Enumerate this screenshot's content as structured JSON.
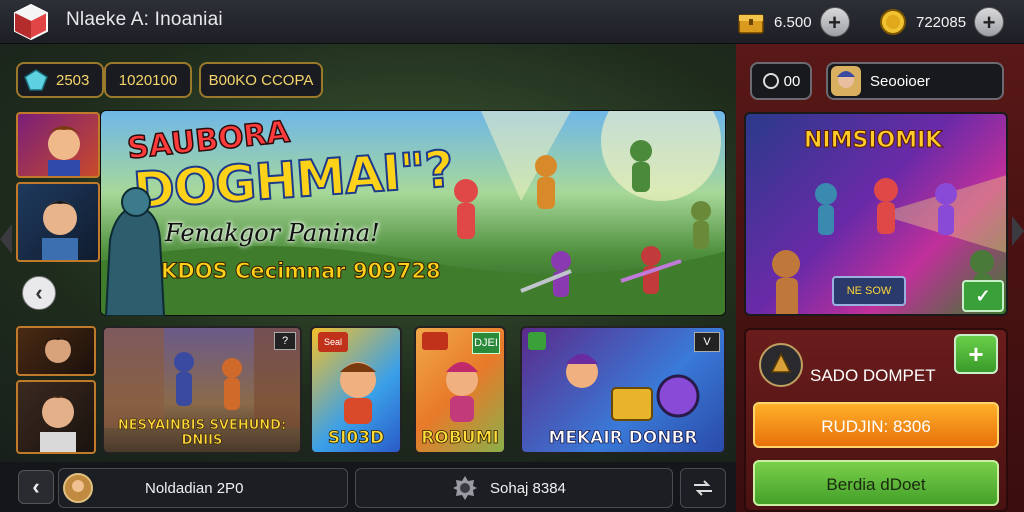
{
  "header": {
    "title": "Nlaeke A: Inoaniai",
    "gold_value": "6.500",
    "coin_value": "722085"
  },
  "chips": {
    "gem_value": "2503",
    "score_value": "1020100",
    "code_label": "B00KO CCOPA"
  },
  "hero": {
    "title_line1": "SAUBORA",
    "title_line2": "DOGHMAI\"?",
    "subtitle": "Fenakgor Panina!",
    "bar_text": "KDOS Cecimnar 909728"
  },
  "cards": [
    {
      "label": "NESYAINBIS SVEHUND: DNIIS",
      "tag": "?"
    },
    {
      "label": "SI03D",
      "tag": "Seal"
    },
    {
      "label": "ROBUMI",
      "tag": "DJEI"
    },
    {
      "label": "MEKAIR DONBR",
      "tag": "V"
    }
  ],
  "right_panel": {
    "counter_value": "00",
    "user_label": "Seooioer",
    "promo_title": "NIMSIOMIK",
    "promo_tag": "NE SOW",
    "wallet_title": "SADO DOMPET",
    "orange_button": "RUDJIN: 8306",
    "green_button": "Berdia dDoet"
  },
  "bottom": {
    "left_label": "Noldadian 2P0",
    "middle_label": "Sohaj 8384"
  },
  "colors": {
    "accent_gold": "#f5d56b",
    "panel_red": "#4a1212",
    "button_orange": "#f28c12",
    "button_green": "#55b635"
  }
}
